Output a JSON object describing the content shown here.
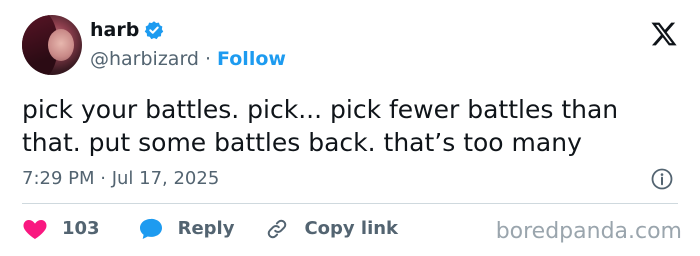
{
  "user": {
    "display_name": "harb",
    "handle": "@harbizard",
    "separator": "·",
    "follow_label": "Follow"
  },
  "tweet": {
    "text": "pick your battles. pick... pick fewer battles than that. put some battles back. that’s too many",
    "timestamp": "7:29 PM · Jul 17, 2025"
  },
  "actions": {
    "like_count": "103",
    "reply_label": "Reply",
    "copy_link_label": "Copy link"
  },
  "icons": {
    "verified": "verified-badge-icon",
    "platform": "x-logo-icon",
    "info": "info-icon",
    "like": "heart-icon",
    "reply": "speech-bubble-icon",
    "copy_link": "link-icon"
  },
  "colors": {
    "accent": "#1d9bf0",
    "like": "#f91880",
    "text": "#0f1419",
    "muted": "#536471",
    "divider": "#cfd9de",
    "watermark": "#9aa5ad"
  },
  "watermark": "boredpanda.com"
}
